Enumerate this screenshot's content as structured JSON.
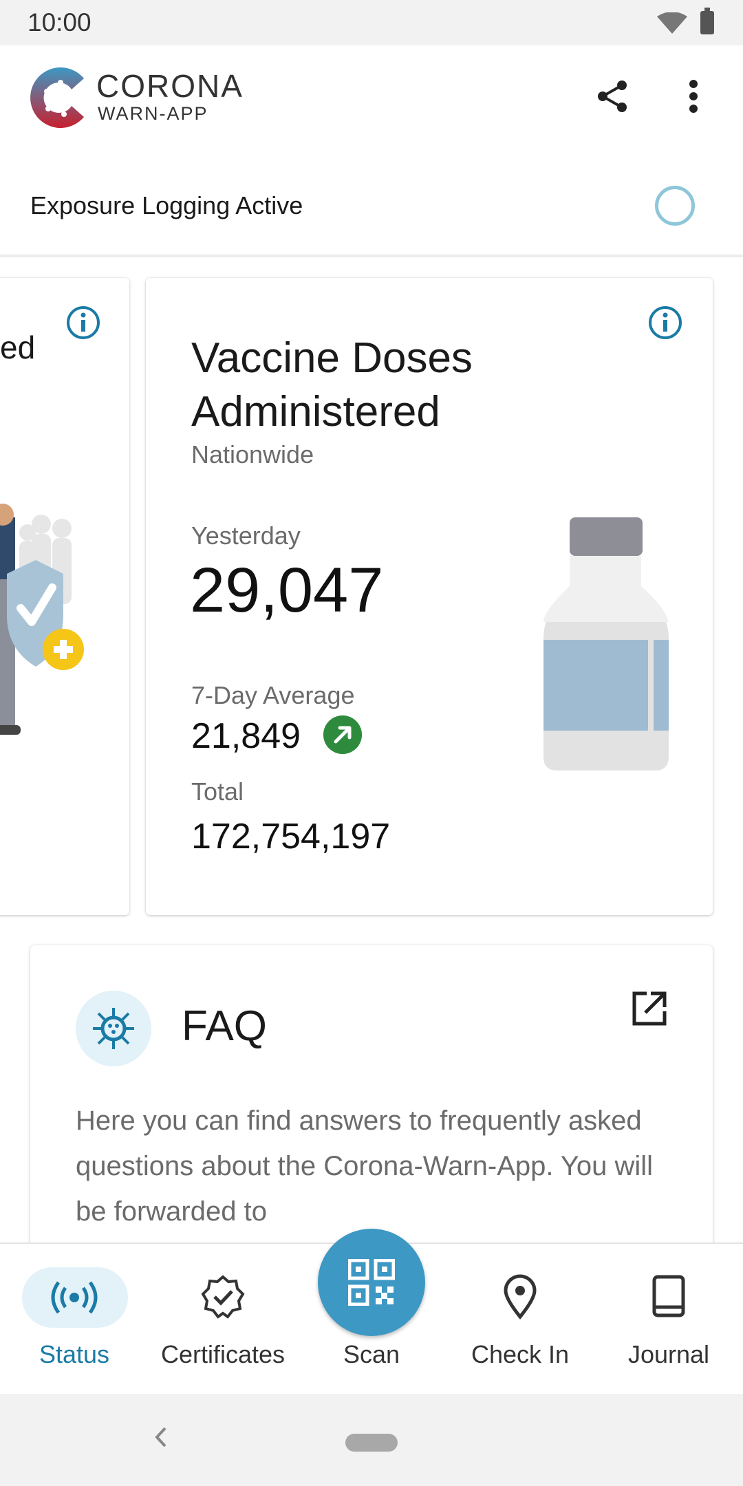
{
  "status_bar": {
    "time": "10:00"
  },
  "app_bar": {
    "logo_title": "CORONA",
    "logo_subtitle": "WARN-APP",
    "share_icon": "share-icon",
    "more_icon": "more-vert-icon"
  },
  "exposure": {
    "label": "Exposure Logging Active"
  },
  "left_card": {
    "partial_text": "ed"
  },
  "vaccine_card": {
    "title": "Vaccine Doses Administered",
    "subtitle": "Nationwide",
    "yesterday_label": "Yesterday",
    "yesterday_value": "29,047",
    "avg_label": "7-Day Average",
    "avg_value": "21,849",
    "trend_icon": "trend-up-icon",
    "total_label": "Total",
    "total_value": "172,754,197"
  },
  "faq": {
    "title": "FAQ",
    "body": "Here you can find answers to frequently asked questions about the Corona-Warn-App. You will be forwarded to"
  },
  "bottom_nav": {
    "items": [
      {
        "label": "Status",
        "icon": "broadcast-icon",
        "active": true
      },
      {
        "label": "Certificates",
        "icon": "certificate-badge-icon"
      },
      {
        "label": "Scan",
        "icon": "qr-code-icon"
      },
      {
        "label": "Check In",
        "icon": "location-pin-icon"
      },
      {
        "label": "Journal",
        "icon": "book-icon"
      }
    ]
  },
  "colors": {
    "accent": "#1a7ba6",
    "fab": "#3d98c4",
    "trend_green": "#2e8b3d",
    "exposure_ring": "#8ec6d9"
  }
}
